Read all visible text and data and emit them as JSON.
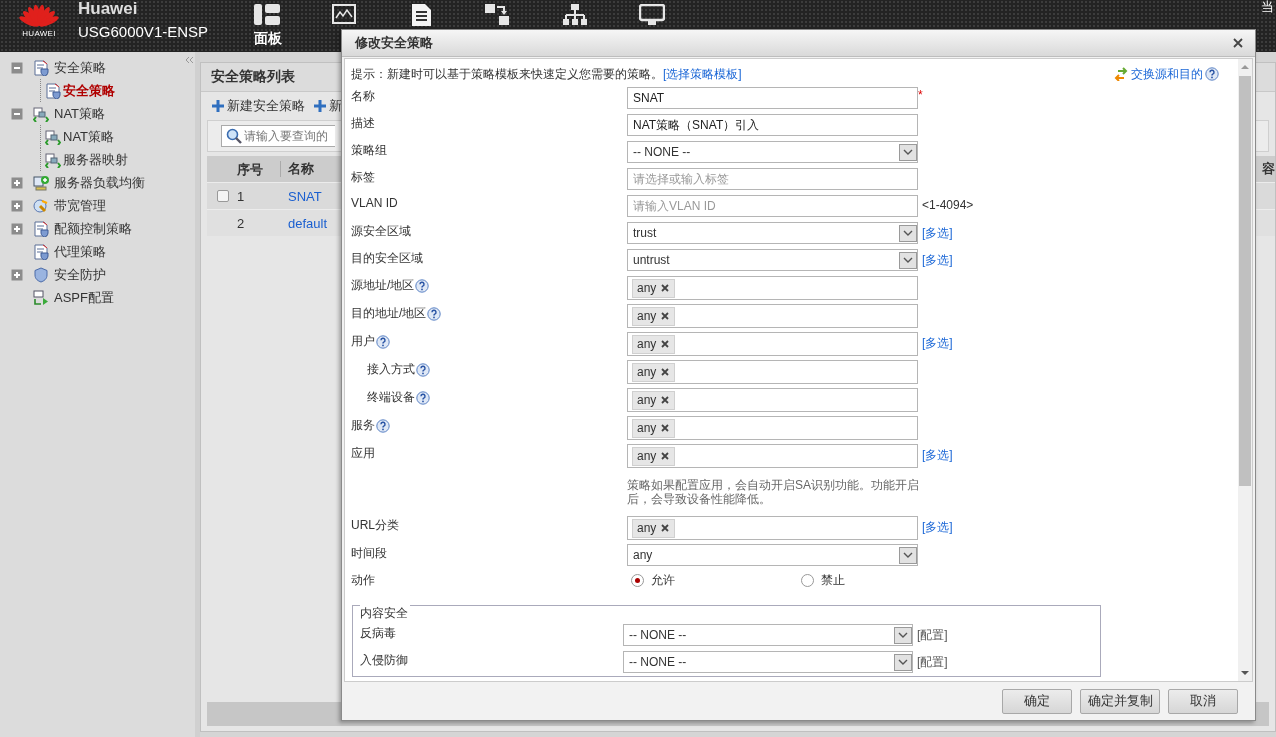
{
  "header": {
    "logo_text": "HUAWEI",
    "brand": "Huawei",
    "device": "USG6000V1-ENSP",
    "nav": [
      {
        "kind": "labeled",
        "label": "面板"
      },
      {
        "kind": "icon"
      },
      {
        "kind": "icon"
      },
      {
        "kind": "icon"
      },
      {
        "kind": "icon"
      },
      {
        "kind": "icon"
      }
    ],
    "user_text": "当"
  },
  "sidebar": {
    "items": [
      {
        "label": "安全策略",
        "expanded": true,
        "selected": false,
        "children": [
          {
            "label": "安全策略",
            "selected": true
          }
        ]
      },
      {
        "label": "NAT策略",
        "expanded": true,
        "selected": false,
        "children": [
          {
            "label": "NAT策略",
            "selected": false
          },
          {
            "label": "服务器映射",
            "selected": false
          }
        ]
      },
      {
        "label": "服务器负载均衡",
        "expanded": false,
        "selected": false
      },
      {
        "label": "带宽管理",
        "expanded": false,
        "selected": false
      },
      {
        "label": "配额控制策略",
        "expanded": false,
        "selected": false
      },
      {
        "label": "代理策略",
        "selected": false
      },
      {
        "label": "安全防护",
        "expanded": false,
        "selected": false
      },
      {
        "label": "ASPF配置",
        "selected": false
      }
    ]
  },
  "list": {
    "title": "安全策略列表",
    "actions": [
      "新建安全策略",
      "新"
    ],
    "search": {
      "placeholder": "请输入要查询的"
    },
    "columns": [
      "序号",
      "名称"
    ],
    "column_3": "容",
    "rows": [
      {
        "index": "1",
        "name": "SNAT",
        "checked": false
      },
      {
        "index": "2",
        "name": "default"
      }
    ]
  },
  "dialog": {
    "title": "修改安全策略",
    "hint": "提示：新建时可以基于策略模板来快速定义您需要的策略。",
    "hint_link": "[选择策略模板]",
    "swap_link": "交换源和目的",
    "fields": [
      {
        "kind": "text",
        "label": "名称",
        "value": "SNAT",
        "required_mark": "*"
      },
      {
        "kind": "text",
        "label": "描述",
        "value": "NAT策略（SNAT）引入"
      },
      {
        "kind": "select",
        "label": "策略组",
        "value": "-- NONE --"
      },
      {
        "kind": "text",
        "label": "标签",
        "placeholder": "请选择或输入标签"
      },
      {
        "kind": "text",
        "label": "VLAN ID",
        "placeholder": "请输入VLAN ID",
        "hint": "<1-4094>"
      },
      {
        "kind": "select",
        "label": "源安全区域",
        "value": "trust",
        "link": "[多选]"
      },
      {
        "kind": "select",
        "label": "目的安全区域",
        "value": "untrust",
        "link": "[多选]"
      },
      {
        "kind": "tags",
        "label": "源地址/地区",
        "help": true,
        "tags": [
          "any"
        ]
      },
      {
        "kind": "tags",
        "label": "目的地址/地区",
        "help": true,
        "tags": [
          "any"
        ]
      },
      {
        "kind": "tags",
        "label": "用户",
        "help": true,
        "tags": [
          "any"
        ],
        "link": "[多选]",
        "children": [
          {
            "kind": "tags",
            "label": "接入方式",
            "help": true,
            "tags": [
              "any"
            ]
          },
          {
            "kind": "tags",
            "label": "终端设备",
            "help": true,
            "tags": [
              "any"
            ]
          }
        ]
      },
      {
        "kind": "tags",
        "label": "服务",
        "help": true,
        "tags": [
          "any"
        ]
      },
      {
        "kind": "tags",
        "label": "应用",
        "tags": [
          "any"
        ],
        "link": "[多选]"
      },
      {
        "kind": "note",
        "text": "策略如果配置应用，会自动开启SA识别功能。功能开启后，会导致设备性能降低。"
      },
      {
        "kind": "tags",
        "label": "URL分类",
        "tags": [
          "any"
        ],
        "link": "[多选]"
      },
      {
        "kind": "select",
        "label": "时间段",
        "value": "any"
      },
      {
        "kind": "radio",
        "label": "动作",
        "options": [
          {
            "label": "允许",
            "selected": true
          },
          {
            "label": "禁止",
            "selected": false
          }
        ]
      }
    ],
    "content_security": {
      "legend": "内容安全",
      "rows": [
        {
          "kind": "select",
          "label": "反病毒",
          "value": "-- NONE --",
          "link": "[配置]"
        },
        {
          "kind": "select",
          "label": "入侵防御",
          "value": "-- NONE --",
          "link": "[配置]"
        }
      ]
    },
    "buttons": [
      "确定",
      "确定并复制",
      "取消"
    ]
  }
}
